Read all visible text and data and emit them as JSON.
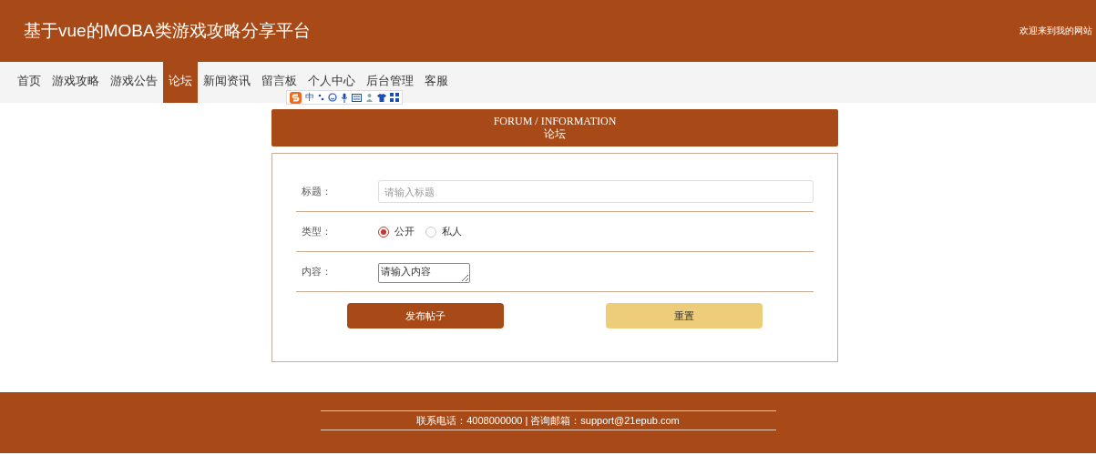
{
  "header": {
    "title": "基于vue的MOBA类游戏攻略分享平台",
    "welcome": "欢迎来到我的网站"
  },
  "nav": [
    {
      "label": "首页",
      "selected": false
    },
    {
      "label": "游戏攻略",
      "selected": false
    },
    {
      "label": "游戏公告",
      "selected": false
    },
    {
      "label": "论坛",
      "selected": true
    },
    {
      "label": "新闻资讯",
      "selected": false
    },
    {
      "label": "留言板",
      "selected": false
    },
    {
      "label": "个人中心",
      "selected": false
    },
    {
      "label": "后台管理",
      "selected": false
    },
    {
      "label": "客服",
      "selected": false
    }
  ],
  "ime_toolbar": {
    "mode": "中"
  },
  "section": {
    "title_en": "FORUM / INFORMATION",
    "title_cn": "论坛"
  },
  "form": {
    "fields": [
      {
        "kind": "text",
        "label": "标题：",
        "placeholder": "请输入标题"
      },
      {
        "kind": "radio",
        "label": "类型：",
        "options": [
          {
            "label": "公开",
            "selected": true
          },
          {
            "label": "私人",
            "selected": false
          }
        ]
      },
      {
        "kind": "textarea",
        "label": "内容：",
        "placeholder": "请输入内容"
      }
    ],
    "buttons": [
      {
        "label": "发布帖子",
        "kind": "primary"
      },
      {
        "label": "重置",
        "kind": "secondary"
      }
    ]
  },
  "footer": {
    "contact": "联系电话：4008000000 | 咨询邮箱：support@21epub.com"
  }
}
